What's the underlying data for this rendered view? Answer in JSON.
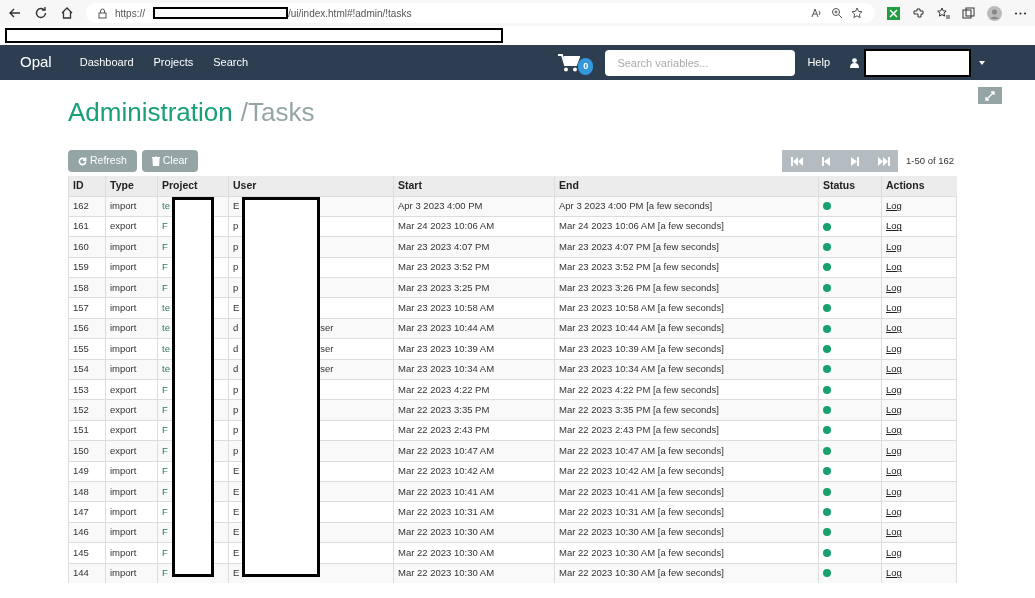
{
  "browser": {
    "url_start": "https://",
    "url_end": "/ui/index.html#!admin/!tasks"
  },
  "navbar": {
    "brand": "Opal",
    "links": [
      "Dashboard",
      "Projects",
      "Search"
    ],
    "cart_count": "0",
    "search": {
      "placeholder": "Search variables..."
    },
    "help": "Help"
  },
  "header": {
    "title": "Administration",
    "subtitle": "/Tasks"
  },
  "toolbar": {
    "buttons": [
      {
        "kind": "refresh",
        "label": "Refresh"
      },
      {
        "kind": "clear",
        "label": "Clear"
      }
    ],
    "pager": {
      "range": "1-50 of 162"
    }
  },
  "table": {
    "columns": [
      "ID",
      "Type",
      "Project",
      "User",
      "Start",
      "End",
      "Status",
      "Actions"
    ],
    "rows": [
      {
        "id": "162",
        "type": "import",
        "project": "te",
        "user": "E",
        "user_tail": "",
        "start": "Apr 3 2023 4:00 PM",
        "end": "Apr 3 2023 4:00 PM [a few seconds]",
        "color": "#18a06e",
        "action": "Log"
      },
      {
        "id": "161",
        "type": "export",
        "project": "F",
        "user": "p",
        "user_tail": "",
        "start": "Mar 24 2023 10:06 AM",
        "end": "Mar 24 2023 10:06 AM [a few seconds]",
        "color": "#18a06e",
        "action": "Log"
      },
      {
        "id": "160",
        "type": "import",
        "project": "F",
        "user": "p",
        "user_tail": "",
        "start": "Mar 23 2023 4:07 PM",
        "end": "Mar 23 2023 4:07 PM [a few seconds]",
        "color": "#18a06e",
        "action": "Log"
      },
      {
        "id": "159",
        "type": "import",
        "project": "F",
        "user": "p",
        "user_tail": "",
        "start": "Mar 23 2023 3:52 PM",
        "end": "Mar 23 2023 3:52 PM [a few seconds]",
        "color": "#18a06e",
        "action": "Log"
      },
      {
        "id": "158",
        "type": "import",
        "project": "F",
        "user": "p",
        "user_tail": "",
        "start": "Mar 23 2023 3:25 PM",
        "end": "Mar 23 2023 3:26 PM [a few seconds]",
        "color": "#18a06e",
        "action": "Log"
      },
      {
        "id": "157",
        "type": "import",
        "project": "te",
        "user": "E",
        "user_tail": "",
        "start": "Mar 23 2023 10:58 AM",
        "end": "Mar 23 2023 10:58 AM [a few seconds]",
        "color": "#18a06e",
        "action": "Log"
      },
      {
        "id": "156",
        "type": "import",
        "project": "te",
        "user": "d",
        "user_tail": "ser",
        "start": "Mar 23 2023 10:44 AM",
        "end": "Mar 23 2023 10:44 AM [a few seconds]",
        "color": "#18a06e",
        "action": "Log"
      },
      {
        "id": "155",
        "type": "import",
        "project": "te",
        "user": "d",
        "user_tail": "ser",
        "start": "Mar 23 2023 10:39 AM",
        "end": "Mar 23 2023 10:39 AM [a few seconds]",
        "color": "#18a06e",
        "action": "Log"
      },
      {
        "id": "154",
        "type": "import",
        "project": "te",
        "user": "d",
        "user_tail": "ser",
        "start": "Mar 23 2023 10:34 AM",
        "end": "Mar 23 2023 10:34 AM [a few seconds]",
        "color": "#18a06e",
        "action": "Log"
      },
      {
        "id": "153",
        "type": "export",
        "project": "F",
        "user": "p",
        "user_tail": "",
        "start": "Mar 22 2023 4:22 PM",
        "end": "Mar 22 2023 4:22 PM [a few seconds]",
        "color": "#18a06e",
        "action": "Log"
      },
      {
        "id": "152",
        "type": "export",
        "project": "F",
        "user": "p",
        "user_tail": "",
        "start": "Mar 22 2023 3:35 PM",
        "end": "Mar 22 2023 3:35 PM [a few seconds]",
        "color": "#18a06e",
        "action": "Log"
      },
      {
        "id": "151",
        "type": "export",
        "project": "F",
        "user": "p",
        "user_tail": "",
        "start": "Mar 22 2023 2:43 PM",
        "end": "Mar 22 2023 2:43 PM [a few seconds]",
        "color": "#18a06e",
        "action": "Log"
      },
      {
        "id": "150",
        "type": "export",
        "project": "F",
        "user": "p",
        "user_tail": "",
        "start": "Mar 22 2023 10:47 AM",
        "end": "Mar 22 2023 10:47 AM [a few seconds]",
        "color": "#18a06e",
        "action": "Log"
      },
      {
        "id": "149",
        "type": "import",
        "project": "F",
        "user": "E",
        "user_tail": "",
        "start": "Mar 22 2023 10:42 AM",
        "end": "Mar 22 2023 10:42 AM [a few seconds]",
        "color": "#18a06e",
        "action": "Log"
      },
      {
        "id": "148",
        "type": "import",
        "project": "F",
        "user": "E",
        "user_tail": "",
        "start": "Mar 22 2023 10:41 AM",
        "end": "Mar 22 2023 10:41 AM [a few seconds]",
        "color": "#18a06e",
        "action": "Log"
      },
      {
        "id": "147",
        "type": "import",
        "project": "F",
        "user": "E",
        "user_tail": "",
        "start": "Mar 22 2023 10:31 AM",
        "end": "Mar 22 2023 10:31 AM [a few seconds]",
        "color": "#18a06e",
        "action": "Log"
      },
      {
        "id": "146",
        "type": "import",
        "project": "F",
        "user": "E",
        "user_tail": "",
        "start": "Mar 22 2023 10:30 AM",
        "end": "Mar 22 2023 10:30 AM [a few seconds]",
        "color": "#18a06e",
        "action": "Log"
      },
      {
        "id": "145",
        "type": "import",
        "project": "F",
        "user": "E",
        "user_tail": "",
        "start": "Mar 22 2023 10:30 AM",
        "end": "Mar 22 2023 10:30 AM [a few seconds]",
        "color": "#18a06e",
        "action": "Log"
      },
      {
        "id": "144",
        "type": "import",
        "project": "F",
        "user": "E",
        "user_tail": "",
        "start": "Mar 22 2023 10:30 AM",
        "end": "Mar 22 2023 10:30 AM [a few seconds]",
        "color": "#18a06e",
        "action": "Log"
      }
    ]
  }
}
